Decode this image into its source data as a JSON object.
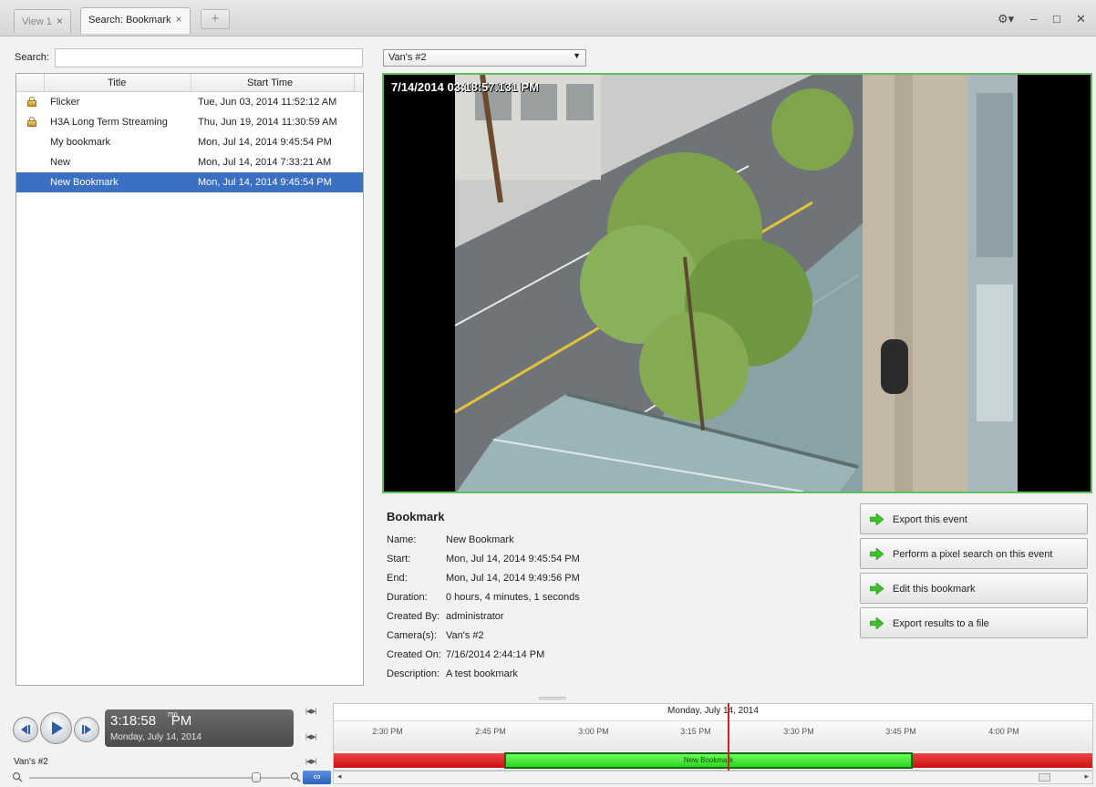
{
  "tabs": [
    {
      "label": "View 1",
      "close": "×"
    },
    {
      "label": "Search: Bookmark",
      "close": "×"
    }
  ],
  "tab_add": "+",
  "window_controls": {
    "settings": "⚙▾",
    "minimize": "–",
    "maximize": "□",
    "close": "✕"
  },
  "search": {
    "label": "Search:",
    "value": ""
  },
  "list": {
    "headers": {
      "title": "Title",
      "start": "Start Time"
    },
    "rows": [
      {
        "title": "Flicker",
        "start": "Tue, Jun 03, 2014 11:52:12 AM",
        "locked": true
      },
      {
        "title": "H3A Long Term Streaming",
        "start": "Thu, Jun 19, 2014 11:30:59 AM",
        "locked": true
      },
      {
        "title": "My bookmark",
        "start": "Mon, Jul 14, 2014 9:45:54 PM",
        "locked": false
      },
      {
        "title": "New",
        "start": "Mon, Jul 14, 2014 7:33:21 AM",
        "locked": false
      },
      {
        "title": "New Bookmark",
        "start": "Mon, Jul 14, 2014 9:45:54 PM",
        "locked": false,
        "selected": true
      }
    ]
  },
  "camera_select": {
    "value": "Van's #2",
    "arrow": "▼"
  },
  "video": {
    "timestamp": "7/14/2014 03:18:57.131 PM"
  },
  "bookmark": {
    "heading": "Bookmark",
    "fields": [
      {
        "label": "Name:",
        "value": "New Bookmark"
      },
      {
        "label": "Start:",
        "value": "Mon, Jul 14, 2014 9:45:54 PM"
      },
      {
        "label": "End:",
        "value": "Mon, Jul 14, 2014 9:49:56 PM"
      },
      {
        "label": "Duration:",
        "value": "0 hours, 4 minutes, 1 seconds"
      },
      {
        "label": "Created By:",
        "value": "administrator"
      },
      {
        "label": "Camera(s):",
        "value": "Van's #2"
      },
      {
        "label": "Created On:",
        "value": "7/16/2014 2:44:14 PM"
      },
      {
        "label": "Description:",
        "value": "A test bookmark"
      }
    ]
  },
  "actions": [
    "Export this event",
    "Perform a pixel search on this event",
    "Edit this bookmark",
    "Export results to a file"
  ],
  "accent_colors": {
    "selection": "#3a6fc2",
    "video_border": "#5fbf5f",
    "timeline_bar": "#cc1f1f",
    "bookmark_bar": "#3de22c"
  },
  "playback": {
    "time": "3:18:58",
    "ms": "750",
    "ampm": "PM",
    "date": "Monday, July 14, 2014"
  },
  "timeline": {
    "date": "Monday, July 14, 2014",
    "ticks": [
      "2:30 PM",
      "2:45 PM",
      "3:00 PM",
      "3:15 PM",
      "3:30 PM",
      "3:45 PM",
      "4:00 PM"
    ],
    "bookmark_label": "New Bookmark"
  },
  "camera_name": "Van's #2",
  "zoom_link_label": "∞"
}
